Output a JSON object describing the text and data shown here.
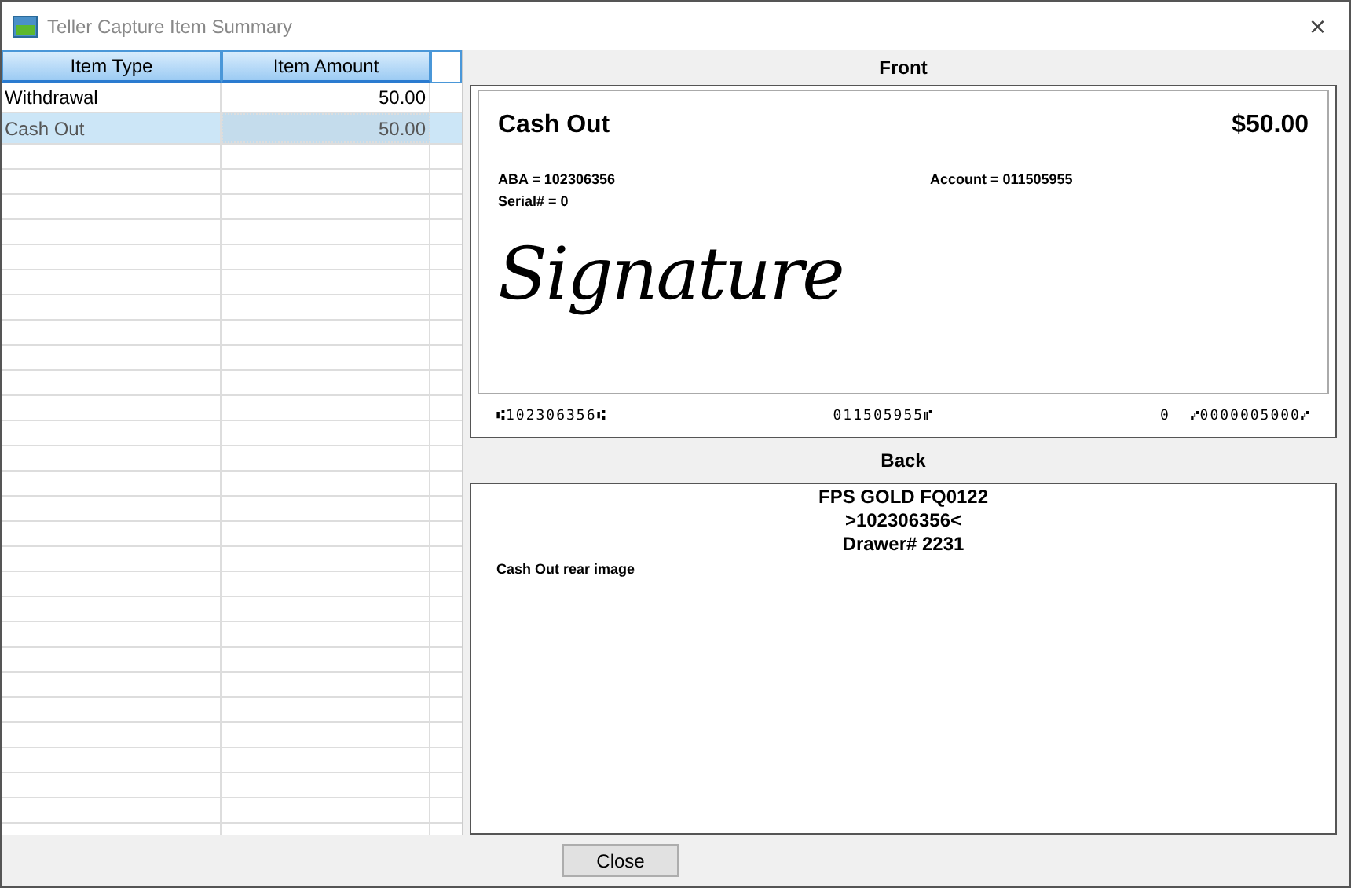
{
  "window": {
    "title": "Teller Capture Item Summary",
    "close": "×"
  },
  "table": {
    "columns": [
      "Item Type",
      "Item Amount"
    ],
    "rows": [
      {
        "item_type": "Withdrawal",
        "item_amount": "50.00",
        "selected": false
      },
      {
        "item_type": "Cash Out",
        "item_amount": "50.00",
        "selected": true
      }
    ]
  },
  "front": {
    "label": "Front",
    "check": {
      "title": "Cash Out",
      "amount": "$50.00",
      "aba": "ABA = 102306356",
      "serial": "Serial# = 0",
      "account": "Account = 011505955",
      "signature": "Signature",
      "micr": [
        "⑆102306356⑆",
        "011505955⑈",
        "0  ⑇0000005000⑇"
      ]
    }
  },
  "back": {
    "label": "Back",
    "lines": [
      "FPS GOLD FQ0122",
      ">102306356<",
      "Drawer# 2231"
    ],
    "note": "Cash Out rear image"
  },
  "buttons": [
    "Close"
  ]
}
